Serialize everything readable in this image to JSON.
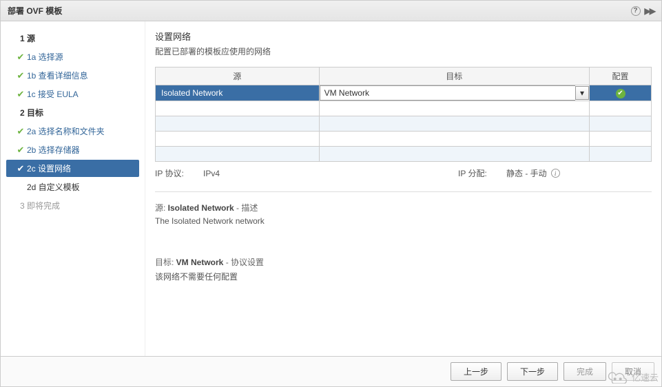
{
  "titlebar": {
    "title": "部署 OVF 模板"
  },
  "sidebar": {
    "steps": [
      {
        "label": "1 源"
      },
      {
        "label": "1a 选择源"
      },
      {
        "label": "1b 查看详细信息"
      },
      {
        "label": "1c 接受 EULA"
      },
      {
        "label": "2 目标"
      },
      {
        "label": "2a 选择名称和文件夹"
      },
      {
        "label": "2b 选择存储器"
      },
      {
        "label": "2c 设置网络"
      },
      {
        "label": "2d 自定义模板"
      },
      {
        "label": "3 即将完成"
      }
    ]
  },
  "main": {
    "title": "设置网络",
    "subtitle": "配置已部署的模板应使用的网络",
    "table": {
      "headers": {
        "source": "源",
        "dest": "目标",
        "config": "配置"
      },
      "row": {
        "source": "Isolated Network",
        "dest": "VM Network"
      }
    },
    "protocol": {
      "ip_protocol_label": "IP 协议:",
      "ip_protocol_value": "IPv4",
      "ip_alloc_label": "IP 分配:",
      "ip_alloc_value": "静态 - 手动"
    },
    "src_desc": {
      "prefix": "源: ",
      "name": "Isolated Network",
      "suffix": " - 描述",
      "body": "The Isolated Network network"
    },
    "dst_desc": {
      "prefix": "目标: ",
      "name": "VM Network",
      "suffix": " - 协议设置",
      "body": "该网络不需要任何配置"
    }
  },
  "footer": {
    "back": "上一步",
    "next": "下一步",
    "finish": "完成",
    "cancel": "取消"
  },
  "watermark": "亿速云"
}
